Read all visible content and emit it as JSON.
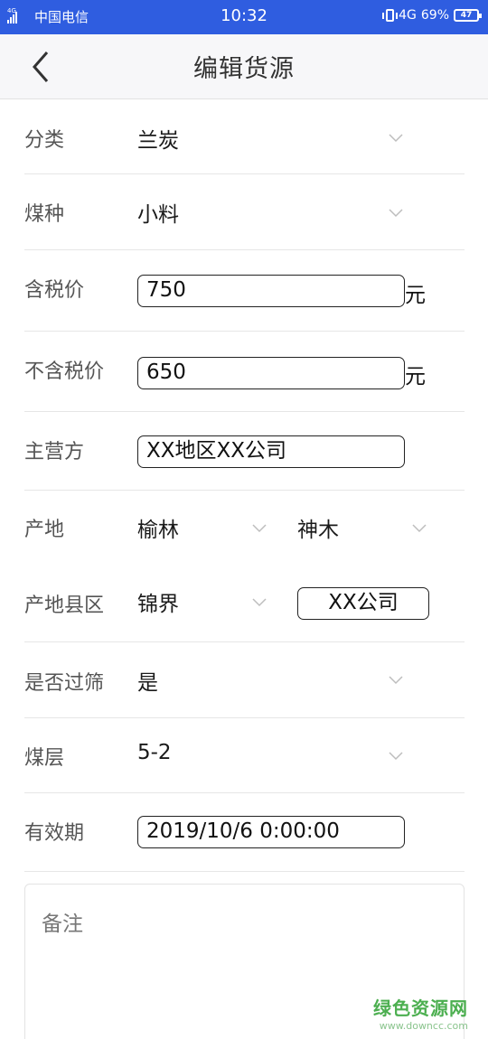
{
  "status_bar": {
    "signal_label": "4G",
    "carrier": "中国电信",
    "time": "10:32",
    "network": "4G",
    "battery_percent": "69%",
    "battery_level": "47"
  },
  "header": {
    "title": "编辑货源"
  },
  "form": {
    "category": {
      "label": "分类",
      "value": "兰炭"
    },
    "coal_type": {
      "label": "煤种",
      "value": "小料"
    },
    "price_tax": {
      "label": "含税价",
      "value": "750",
      "unit": "元"
    },
    "price_notax": {
      "label": "不含税价",
      "value": "650",
      "unit": "元"
    },
    "operator": {
      "label": "主营方",
      "value": "XX地区XX公司"
    },
    "origin": {
      "label": "产地",
      "value_a": "榆林",
      "value_b": "神木"
    },
    "county": {
      "label": "产地县区",
      "value": "锦界",
      "company": "XX公司"
    },
    "screened": {
      "label": "是否过筛",
      "value": "是"
    },
    "seam": {
      "label": "煤层",
      "value": "5-2"
    },
    "validity": {
      "label": "有效期",
      "value": "2019/10/6 0:00:00"
    },
    "remark": {
      "placeholder": "备注"
    }
  },
  "watermark": {
    "brand": "绿色资源网",
    "url": "www.downcc.com"
  }
}
